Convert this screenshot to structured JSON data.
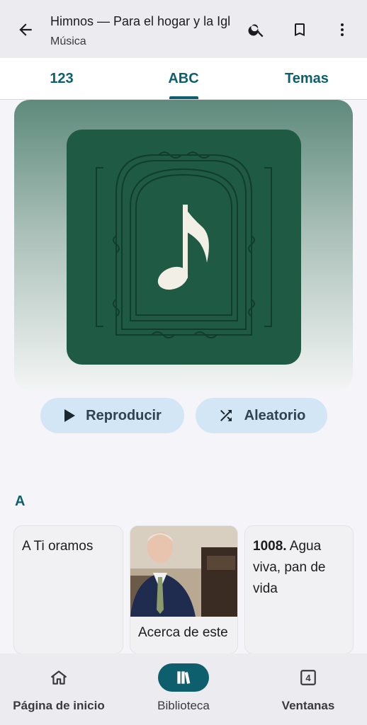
{
  "appbar": {
    "title": "Himnos — Para el hogar y la Igl",
    "subtitle": "Música",
    "icons": [
      "back-arrow-icon",
      "search-icon",
      "bookmark-icon",
      "more-vert-icon"
    ]
  },
  "tabs": [
    {
      "label": "123"
    },
    {
      "label": "ABC",
      "selected": true
    },
    {
      "label": "Temas"
    }
  ],
  "actions": {
    "play_label": "Reproducir",
    "shuffle_label": "Aleatorio"
  },
  "section": {
    "letter": "A",
    "cards": [
      {
        "title": "A Ti oramos"
      },
      {
        "title": "Acerca de este"
      },
      {
        "number": "1008.",
        "title": "Agua viva, pan de vida"
      }
    ]
  },
  "bottom_nav": [
    {
      "label": "Página de inicio",
      "icon": "home-icon"
    },
    {
      "label": "Biblioteca",
      "icon": "library-icon",
      "selected": true
    },
    {
      "label": "Ventanas",
      "icon": "windows-icon",
      "badge": "4"
    }
  ],
  "colors": {
    "accent": "#0e5f6e",
    "cover_green": "#1e5a44",
    "pill_bg": "#d3e6f5"
  }
}
